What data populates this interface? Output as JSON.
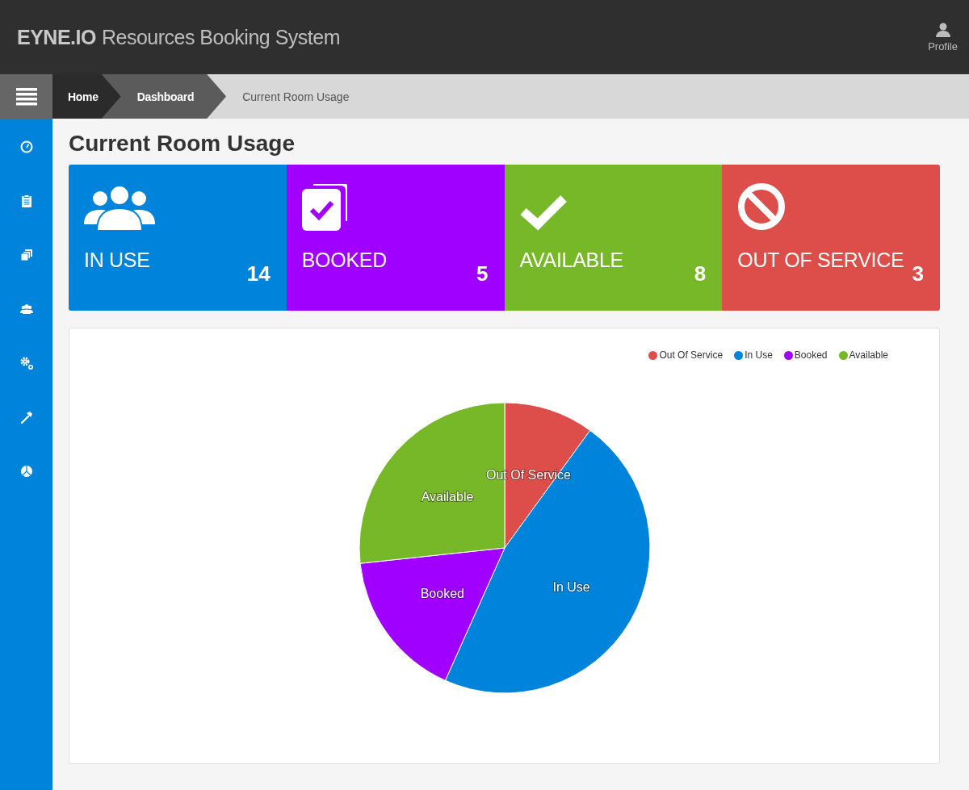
{
  "header": {
    "brand": "EYNE.IO",
    "title": "Resources Booking System",
    "profile": "Profile"
  },
  "breadcrumb": [
    "Home",
    "Dashboard",
    "Current Room Usage"
  ],
  "page_title": "Current Room Usage",
  "cards": [
    {
      "label": "IN USE",
      "count": "14",
      "color": "#0083db"
    },
    {
      "label": "BOOKED",
      "count": "5",
      "color": "#a000ff"
    },
    {
      "label": "AVAILABLE",
      "count": "8",
      "color": "#77b829"
    },
    {
      "label": "OUT OF SERVICE",
      "count": "3",
      "color": "#dd4e4a"
    }
  ],
  "legend": [
    {
      "label": "Out Of Service",
      "color": "#dd4e4a"
    },
    {
      "label": "In Use",
      "color": "#0083db"
    },
    {
      "label": "Booked",
      "color": "#a000ff"
    },
    {
      "label": "Available",
      "color": "#77b829"
    }
  ],
  "chart_data": {
    "type": "pie",
    "categories": [
      "Out Of Service",
      "In Use",
      "Booked",
      "Available"
    ],
    "values": [
      10,
      46.7,
      16.6,
      26.7
    ]
  }
}
